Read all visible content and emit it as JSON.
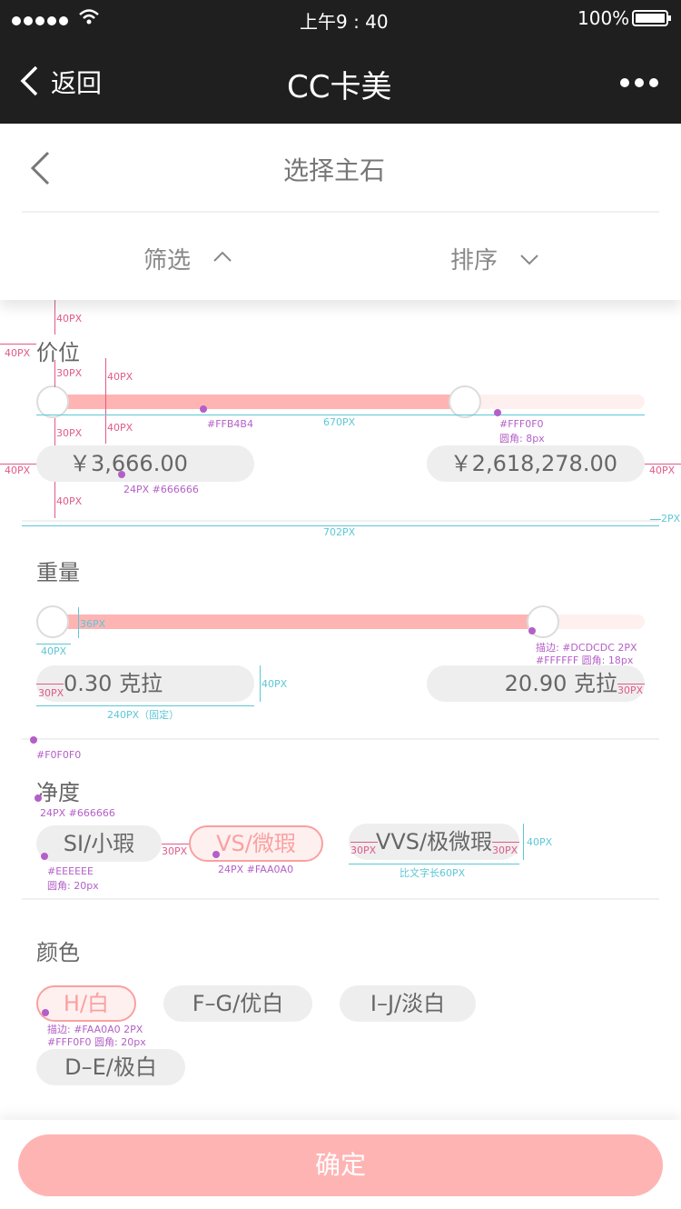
{
  "status": {
    "time": "上午9 : 40",
    "battery": "100%"
  },
  "nav": {
    "back_label": "返回",
    "title": "CC卡美",
    "more": "•••"
  },
  "header": {
    "title": "选择主石",
    "filter_label": "筛选",
    "sort_label": "排序"
  },
  "price": {
    "title": "价位",
    "min_label": "￥3,666.00",
    "max_label": "￥2,618,278.00",
    "range_fraction": [
      0,
      0.7
    ]
  },
  "weight": {
    "title": "重量",
    "min_label": "0.30 克拉",
    "max_label": "20.90 克拉",
    "range_fraction": [
      0,
      0.83
    ]
  },
  "clarity": {
    "title": "净度",
    "options": [
      "SI/小瑕",
      "VS/微瑕",
      "VVS/极微瑕"
    ],
    "selected": "VS/微瑕"
  },
  "color": {
    "title": "颜色",
    "options": [
      "H/白",
      "F–G/优白",
      "I–J/淡白",
      "D–E/极白"
    ],
    "selected": "H/白"
  },
  "confirm_label": "确定",
  "annotations": {
    "a40": "40PX",
    "a30": "30PX",
    "a36": "36PX",
    "a2": "2PX",
    "a670": "670PX",
    "a702": "702PX",
    "a240": "240PX（固定）",
    "track_color": "#FFB4B4",
    "track_bg": "#FFF0F0",
    "track_bg_radius": "圆角: 8px",
    "price_font": "24PX #666666",
    "knob_stroke": "描边: #DCDCDC  2PX",
    "knob_fill": "#FFFFFF  圆角: 18px",
    "divider_color": "#F0F0F0",
    "title_font": "24PX #666666",
    "pill_bg": "#EEEEEE",
    "pill_radius": "圆角: 20px",
    "sel_font": "24PX #FAA0A0",
    "text_width": "比文字长60PX",
    "sel_stroke": "描边: #FAA0A0  2PX",
    "sel_fill": "#FFF0F0  圆角: 20px"
  },
  "colors": {
    "accent": "#FFB4B4",
    "selected": "#FAA0A0",
    "selected_bg": "#FFF0F0",
    "pill_bg": "#EEEEEE",
    "text": "#666666",
    "dark": "#1f1f1f"
  }
}
